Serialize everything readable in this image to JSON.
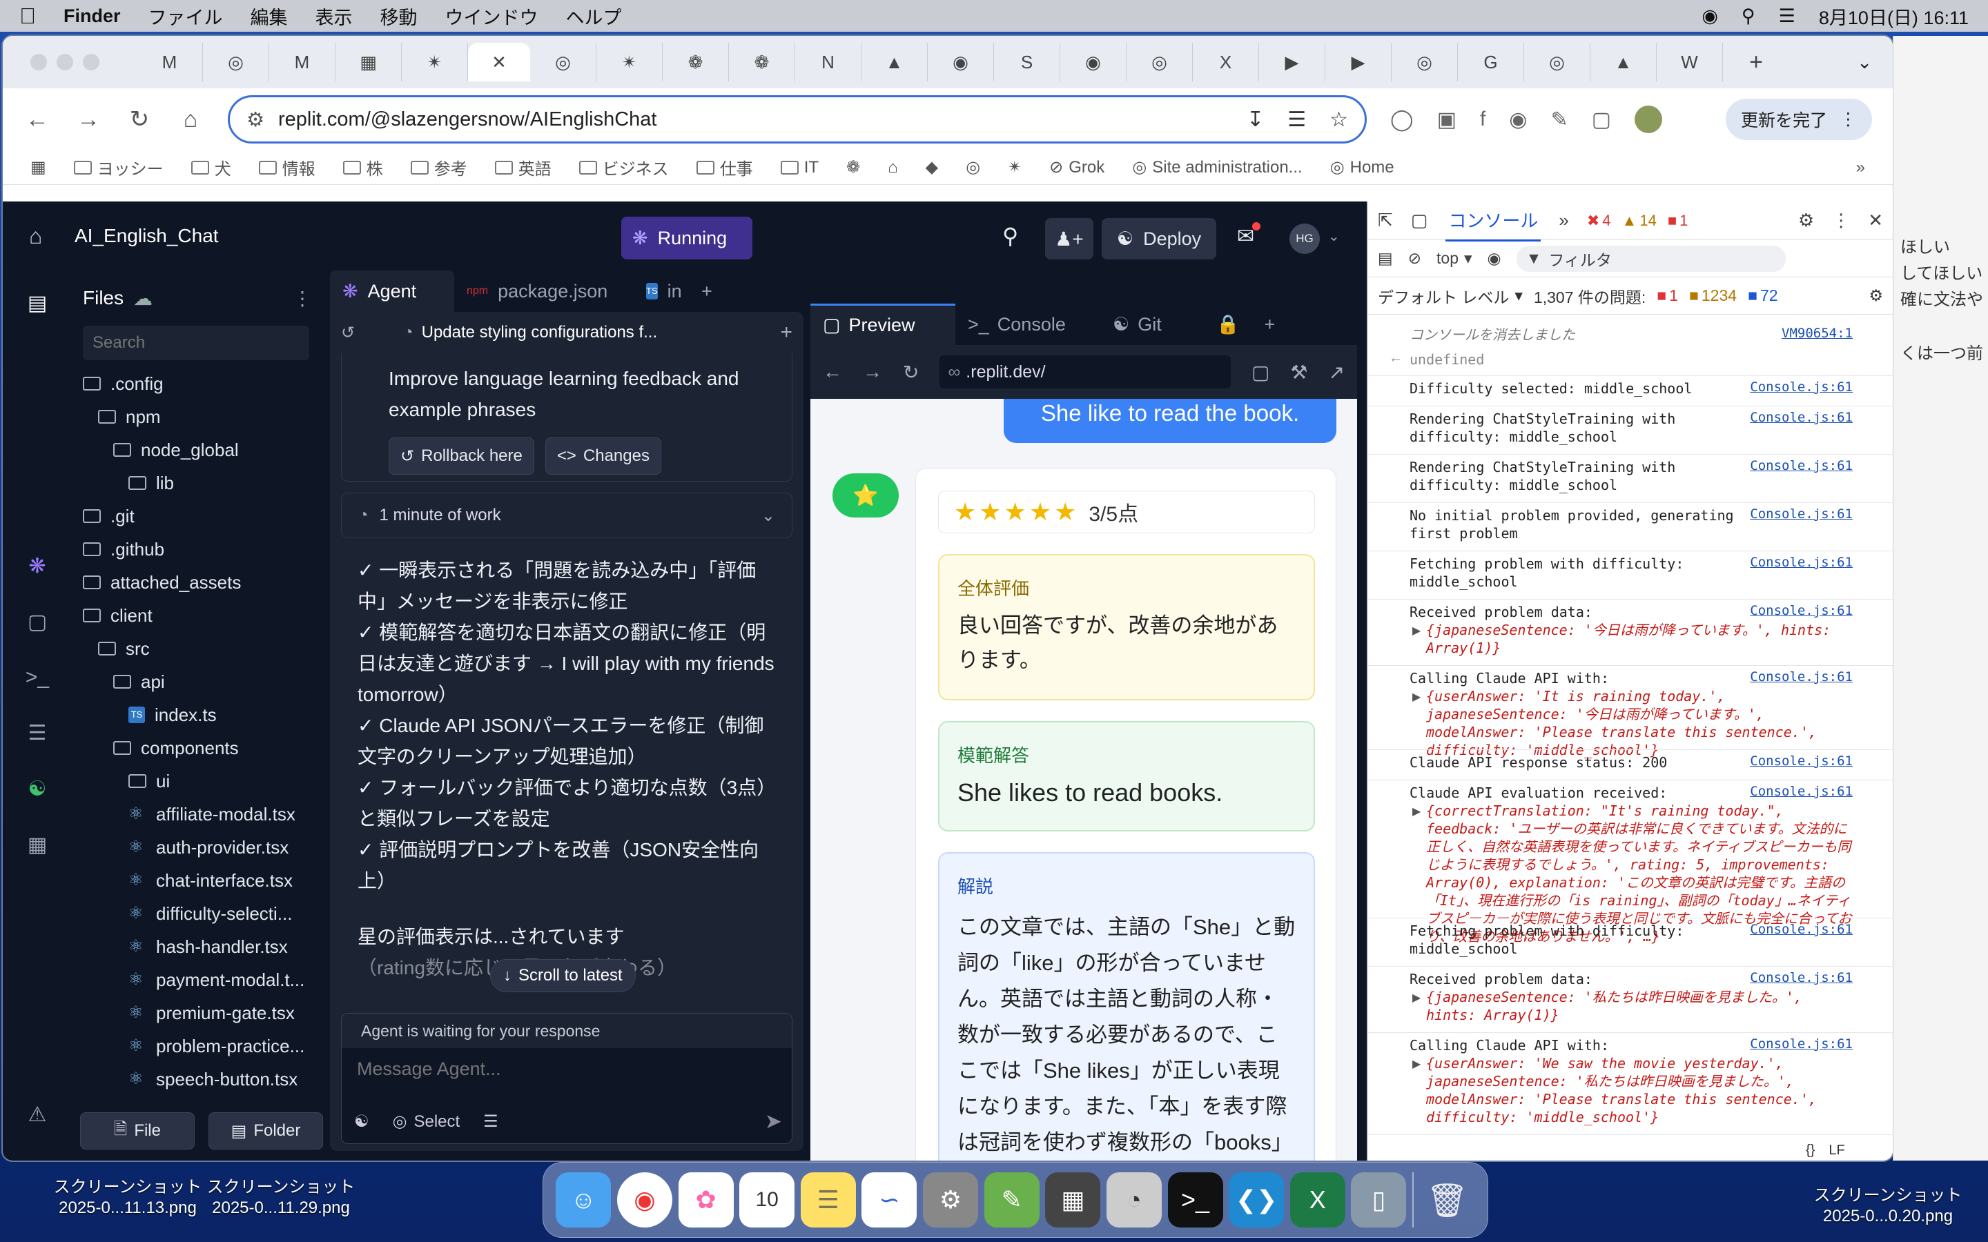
{
  "menubar": {
    "app": "Finder",
    "items": [
      "ファイル",
      "編集",
      "表示",
      "移動",
      "ウインドウ",
      "ヘルプ"
    ],
    "datetime": "8月10日(日)  16:11"
  },
  "browser": {
    "url": "replit.com/@slazengersnow/AIEnglishChat",
    "update_label": "更新を完了",
    "bookmarks": [
      "ヨッシー",
      "犬",
      "情報",
      "株",
      "参考",
      "英語",
      "ビジネス",
      "仕事",
      "IT",
      "Grok",
      "Site administration...",
      "Home"
    ]
  },
  "replit": {
    "project": "AI_English_Chat",
    "running": "Running",
    "deploy": "Deploy",
    "avatar": "HG",
    "files": {
      "title": "Files",
      "search_placeholder": "Search",
      "tree": [
        {
          "name": ".config",
          "type": "folder",
          "indent": 0
        },
        {
          "name": "npm",
          "type": "folder",
          "indent": 1
        },
        {
          "name": "node_global",
          "type": "folder",
          "indent": 2
        },
        {
          "name": "lib",
          "type": "folder",
          "indent": 3
        },
        {
          "name": ".git",
          "type": "folder",
          "indent": 0
        },
        {
          "name": ".github",
          "type": "folder",
          "indent": 0
        },
        {
          "name": "attached_assets",
          "type": "folder",
          "indent": 0
        },
        {
          "name": "client",
          "type": "folder",
          "indent": 0
        },
        {
          "name": "src",
          "type": "folder",
          "indent": 1
        },
        {
          "name": "api",
          "type": "folder",
          "indent": 2
        },
        {
          "name": "index.ts",
          "type": "ts",
          "indent": 3
        },
        {
          "name": "components",
          "type": "folder",
          "indent": 2
        },
        {
          "name": "ui",
          "type": "folder",
          "indent": 3
        },
        {
          "name": "affiliate-modal.tsx",
          "type": "react",
          "indent": 3
        },
        {
          "name": "auth-provider.tsx",
          "type": "react",
          "indent": 3
        },
        {
          "name": "chat-interface.tsx",
          "type": "react",
          "indent": 3
        },
        {
          "name": "difficulty-selecti...",
          "type": "react",
          "indent": 3
        },
        {
          "name": "hash-handler.tsx",
          "type": "react",
          "indent": 3
        },
        {
          "name": "payment-modal.t...",
          "type": "react",
          "indent": 3
        },
        {
          "name": "premium-gate.tsx",
          "type": "react",
          "indent": 3
        },
        {
          "name": "problem-practice...",
          "type": "react",
          "indent": 3
        },
        {
          "name": "speech-button.tsx",
          "type": "react",
          "indent": 3
        }
      ],
      "file_btn": "File",
      "folder_btn": "Folder"
    },
    "agent": {
      "tabs": [
        "Agent",
        "package.json",
        "in"
      ],
      "checkpoint_title": "Update styling configurations f...",
      "improve_text": "Improve language learning feedback and example phrases",
      "rollback": "Rollback here",
      "changes": "Changes",
      "work": "1 minute of work",
      "bullets": [
        "✓ 一瞬表示される「問題を読み込み中」「評価中」メッセージを非表示に修正",
        "✓ 模範解答を適切な日本語文の翻訳に修正（明日は友達と遊びます → I will play with my friends tomorrow）",
        "✓ Claude API JSONパースエラーを修正（制御文字のクリーンアップ処理追加）",
        "✓ フォールバック評価でより適切な点数（3点）と類似フレーズを設定",
        "✓ 評価説明プロンプトを改善（JSON安全性向上）"
      ],
      "trailing": "星の評価表示は...されています",
      "trailing2": "（rating数に応じて星の色が変わる）",
      "scroll_latest": "Scroll to latest",
      "waiting": "Agent is waiting for your response",
      "message_placeholder": "Message Agent...",
      "select": "Select"
    },
    "preview": {
      "tabs": [
        "Preview",
        "Console",
        "Git"
      ],
      "url": ".replit.dev/",
      "user_bubble": "She like to read the book.",
      "rating": "3/5点",
      "overall_title": "全体評価",
      "overall_text": "良い回答ですが、改善の余地があります。",
      "model_title": "模範解答",
      "model_text": "She likes to read books.",
      "expl_title": "解説",
      "expl_text": "この文章では、主語の「She」と動詞の「like」の形が合っていません。英語では主語と動詞の人称・数が一致する必要があるので、ここでは「She likes」が正しい表現になります。また、「本」を表す際は冠詞を使わず複数形の「books」とするのが自然です。"
    }
  },
  "devtools": {
    "tab": "コンソール",
    "errors": "4",
    "warnings": "14",
    "issues_badge": "1",
    "context": "top",
    "filter_placeholder": "フィルタ",
    "level": "デフォルト レベル",
    "issues": "1,307 件の問題:",
    "i1": "1",
    "i2": "1234",
    "i3": "72",
    "cleared": "コンソールを消去しました",
    "cleared_src": "VM90654:1",
    "undefined": "undefined",
    "src": "Console.js:61",
    "logs": [
      {
        "text": "Difficulty selected: middle_school"
      },
      {
        "text": "Rendering ChatStyleTraining with difficulty: middle_school"
      },
      {
        "text": "Rendering ChatStyleTraining with difficulty: middle_school"
      },
      {
        "text": "No initial problem provided, generating first problem"
      },
      {
        "text": "Fetching problem with difficulty: middle_school"
      },
      {
        "text": "Received problem data:",
        "obj": "{japaneseSentence: '今日は雨が降っています。', hints: Array(1)}"
      },
      {
        "text": "Calling Claude API with:",
        "obj": "{userAnswer: 'It is raining today.', japaneseSentence: '今日は雨が降っています。', modelAnswer: 'Please translate this sentence.', difficulty: 'middle_school'}"
      },
      {
        "text": "Claude API response status: 200"
      },
      {
        "text": "Claude API evaluation received:",
        "obj": "{correctTranslation: \"It's raining today.\", feedback: 'ユーザーの英訳は非常に良くできています。文法的に正しく、自然な英語表現を使っています。ネイティブスピーカーも同じように表現するでしょう。', rating: 5, improvements: Array(0), explanation: 'この文章の英訳は完璧です。主語の「It」、現在進行形の「is raining」、副詞の「today」…ネイティブスピーカーが実際に使う表現と同じです。文脈にも完全に合っており、改善の余地はありません。', …}"
      },
      {
        "text": "Fetching problem with difficulty: middle_school"
      },
      {
        "text": "Received problem data:",
        "obj": "{japaneseSentence: '私たちは昨日映画を見ました。', hints: Array(1)}"
      },
      {
        "text": "Calling Claude API with:",
        "obj": "{userAnswer: 'We saw the movie yesterday.', japaneseSentence: '私たちは昨日映画を見ました。', modelAnswer: 'Please translate this sentence.', difficulty: 'middle_school'}"
      },
      {
        "text": "Claude API response status: 200"
      },
      {
        "text": "Claude API evaluation received:"
      }
    ],
    "lf": "LF"
  },
  "side_partial": [
    "ほしい",
    "してほしい",
    "確に文法や",
    "くは一つ前"
  ],
  "desktop": {
    "icon1": "スクリーンショット\n2025-0...11.13.png",
    "icon2": "スクリーンショット\n2025-0...11.29.png",
    "icon3": "スクリーンショット\n2025-0...0.20.png"
  }
}
